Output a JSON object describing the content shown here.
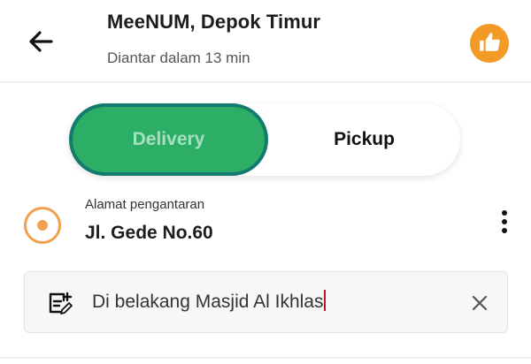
{
  "header": {
    "title": "MeeNUM, Depok Timur",
    "subtitle": "Diantar dalam 13 min",
    "back_icon": "arrow-left-icon",
    "badge_icon": "thumbs-up-icon",
    "badge_color": "#f19a26"
  },
  "order_mode": {
    "options": [
      "Delivery",
      "Pickup"
    ],
    "selected": "Delivery",
    "selected_color": "#2cae67"
  },
  "address": {
    "label": "Alamat pengantaran",
    "value": "Jl. Gede No.60",
    "pin_icon": "location-pin-icon",
    "more_icon": "more-vertical-icon"
  },
  "note": {
    "value": "Di belakang Masjid Al Ikhlas",
    "note_icon": "note-edit-icon",
    "clear_icon": "close-icon"
  }
}
